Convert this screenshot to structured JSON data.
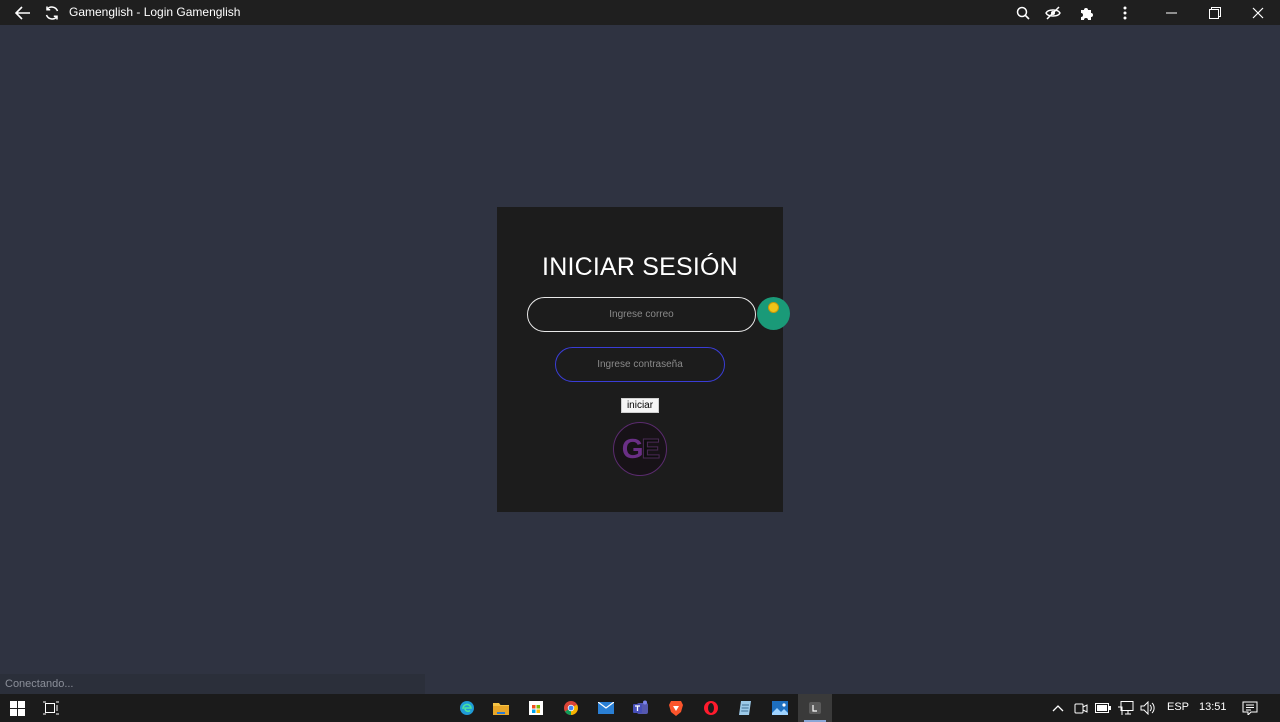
{
  "window": {
    "title": "Gamenglish - Login Gamenglish"
  },
  "login": {
    "heading": "INICIAR SESIÓN",
    "email_placeholder": "Ingrese correo",
    "password_placeholder": "Ingrese contraseña",
    "submit_label": "iniciar",
    "logo_text": "GE"
  },
  "status": {
    "text": "Conectando..."
  },
  "taskbar": {
    "language": "ESP",
    "time": "13:51"
  },
  "colors": {
    "page_background": "#2f3341",
    "card_background": "#1c1c1c",
    "password_border": "#3a3dd6",
    "badge": "#1a9a78"
  }
}
